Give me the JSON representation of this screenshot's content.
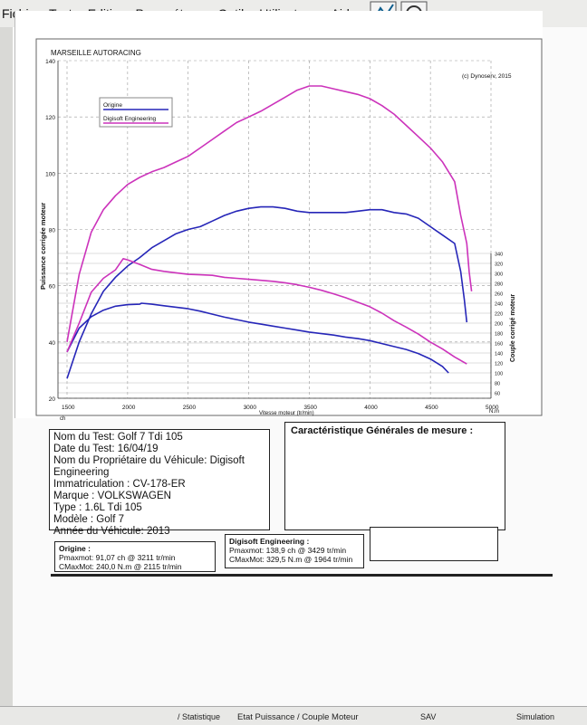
{
  "menu": [
    "Fichier",
    "Tests",
    "Edition",
    "Paramétrage",
    "Outils",
    "Utilisateurs",
    "Aide"
  ],
  "chart_data": {
    "type": "line",
    "title": "MARSEILLE AUTORACING",
    "copyright": "(c) Dynoserv, 2015",
    "xlabel": "Vitesse moteur (tr/min)",
    "xunit_left": "ch",
    "xunit_right": "N.m",
    "ylabel_left": "Puissance corrigée moteur",
    "ylabel_right": "Couple corrigé moteur",
    "xlim": [
      1500,
      5000
    ],
    "ylim_left": [
      20,
      140
    ],
    "ylim_right": [
      60,
      340
    ],
    "x_ticks": [
      1500,
      2000,
      2500,
      3000,
      3500,
      4000,
      4500,
      5000
    ],
    "y_ticks_left": [
      20,
      40,
      60,
      80,
      100,
      120,
      140
    ],
    "y_ticks_right": [
      60,
      80,
      100,
      120,
      140,
      160,
      180,
      200,
      220,
      240,
      260,
      280,
      300,
      320,
      340
    ],
    "grid": true,
    "legend_position": "top-left",
    "series": [
      {
        "name": "Origine",
        "color": "#2626b8",
        "power_ch": [
          [
            1500,
            27
          ],
          [
            1600,
            40
          ],
          [
            1700,
            50
          ],
          [
            1800,
            58
          ],
          [
            1900,
            63
          ],
          [
            2000,
            67
          ],
          [
            2100,
            70
          ],
          [
            2200,
            73.5
          ],
          [
            2300,
            76
          ],
          [
            2400,
            78.5
          ],
          [
            2500,
            80
          ],
          [
            2600,
            81
          ],
          [
            2700,
            83
          ],
          [
            2800,
            85
          ],
          [
            2900,
            86.5
          ],
          [
            3000,
            87.5
          ],
          [
            3100,
            88
          ],
          [
            3200,
            88
          ],
          [
            3300,
            87.5
          ],
          [
            3400,
            86.5
          ],
          [
            3500,
            86
          ],
          [
            3600,
            86
          ],
          [
            3700,
            86
          ],
          [
            3800,
            86
          ],
          [
            3900,
            86.5
          ],
          [
            4000,
            87
          ],
          [
            4100,
            87
          ],
          [
            4200,
            86
          ],
          [
            4300,
            85.5
          ],
          [
            4400,
            84
          ],
          [
            4500,
            81
          ],
          [
            4600,
            78
          ],
          [
            4700,
            75
          ],
          [
            4750,
            65
          ],
          [
            4780,
            55
          ],
          [
            4800,
            47
          ]
        ],
        "torque_nm": [
          [
            1500,
            142
          ],
          [
            1600,
            190
          ],
          [
            1700,
            213
          ],
          [
            1800,
            226
          ],
          [
            1900,
            234
          ],
          [
            2000,
            237
          ],
          [
            2100,
            238
          ],
          [
            2115,
            240
          ],
          [
            2200,
            238
          ],
          [
            2300,
            235
          ],
          [
            2400,
            232
          ],
          [
            2500,
            229
          ],
          [
            2600,
            224
          ],
          [
            2700,
            218
          ],
          [
            2800,
            212
          ],
          [
            2900,
            207
          ],
          [
            3000,
            202
          ],
          [
            3100,
            198
          ],
          [
            3200,
            194
          ],
          [
            3300,
            190
          ],
          [
            3400,
            186
          ],
          [
            3500,
            182
          ],
          [
            3600,
            179
          ],
          [
            3700,
            176
          ],
          [
            3800,
            172
          ],
          [
            3900,
            169
          ],
          [
            4000,
            165
          ],
          [
            4100,
            159
          ],
          [
            4200,
            153
          ],
          [
            4300,
            147
          ],
          [
            4400,
            139
          ],
          [
            4500,
            128
          ],
          [
            4600,
            113
          ],
          [
            4650,
            100
          ]
        ]
      },
      {
        "name": "Digisoft Engineering",
        "color": "#cc33bb",
        "power_ch": [
          [
            1500,
            40
          ],
          [
            1600,
            64
          ],
          [
            1700,
            79
          ],
          [
            1800,
            87
          ],
          [
            1900,
            92
          ],
          [
            2000,
            96
          ],
          [
            2100,
            98.5
          ],
          [
            2200,
            100.5
          ],
          [
            2300,
            102
          ],
          [
            2400,
            104
          ],
          [
            2500,
            106
          ],
          [
            2600,
            109
          ],
          [
            2700,
            112
          ],
          [
            2800,
            115
          ],
          [
            2900,
            118
          ],
          [
            3000,
            120
          ],
          [
            3100,
            122
          ],
          [
            3200,
            124.5
          ],
          [
            3300,
            127
          ],
          [
            3400,
            129.5
          ],
          [
            3500,
            131
          ],
          [
            3600,
            131
          ],
          [
            3700,
            130
          ],
          [
            3800,
            129
          ],
          [
            3900,
            128
          ],
          [
            4000,
            126.5
          ],
          [
            4100,
            124
          ],
          [
            4200,
            121
          ],
          [
            4300,
            117
          ],
          [
            4400,
            113
          ],
          [
            4500,
            109
          ],
          [
            4600,
            104
          ],
          [
            4700,
            97
          ],
          [
            4750,
            85
          ],
          [
            4800,
            75
          ],
          [
            4820,
            65
          ],
          [
            4840,
            58
          ]
        ],
        "torque_nm": [
          [
            1500,
            142
          ],
          [
            1600,
            200
          ],
          [
            1700,
            262
          ],
          [
            1800,
            290
          ],
          [
            1900,
            307
          ],
          [
            1964,
            329.5
          ],
          [
            2000,
            327
          ],
          [
            2100,
            318
          ],
          [
            2200,
            308
          ],
          [
            2300,
            304
          ],
          [
            2400,
            301
          ],
          [
            2500,
            298
          ],
          [
            2600,
            297
          ],
          [
            2700,
            296
          ],
          [
            2800,
            292
          ],
          [
            2900,
            290
          ],
          [
            3000,
            288
          ],
          [
            3100,
            286
          ],
          [
            3200,
            284
          ],
          [
            3300,
            281
          ],
          [
            3400,
            277
          ],
          [
            3500,
            272
          ],
          [
            3600,
            266
          ],
          [
            3700,
            259
          ],
          [
            3800,
            251
          ],
          [
            3900,
            242
          ],
          [
            4000,
            233
          ],
          [
            4100,
            220
          ],
          [
            4200,
            205
          ],
          [
            4300,
            192
          ],
          [
            4400,
            178
          ],
          [
            4500,
            162
          ],
          [
            4600,
            148
          ],
          [
            4700,
            132
          ],
          [
            4800,
            118
          ]
        ]
      }
    ]
  },
  "info": {
    "lines": [
      "Nom du Test: Golf 7 Tdi 105",
      "Date du Test: 16/04/19",
      "Nom du Propriétaire du Véhicule: Digisoft",
      "Engineering",
      "Immatriculation  : CV-178-ER",
      "Marque  : VOLKSWAGEN",
      "Type  : 1.6L Tdi 105",
      "Modèle  : Golf 7",
      "Année du Véhicule: 2013"
    ]
  },
  "car": {
    "title": "Caractéristique Générales de mesure :"
  },
  "results": {
    "origine": {
      "title": "Origine :",
      "pmax": "Pmaxmot: 91,07 ch @ 3211 tr/min",
      "cmax": "CMaxMot: 240,0 N.m @ 2115 tr/min"
    },
    "digisoft": {
      "title": "Digisoft Engineering :",
      "pmax": "Pmaxmot: 138,9 ch @ 3429 tr/min",
      "cmax": "CMaxMot: 329,5 N.m @ 1964 tr/min"
    }
  },
  "tabs": [
    "/ Statistique",
    "Etat Puissance / Couple Moteur",
    "SAV",
    "Simulation"
  ]
}
